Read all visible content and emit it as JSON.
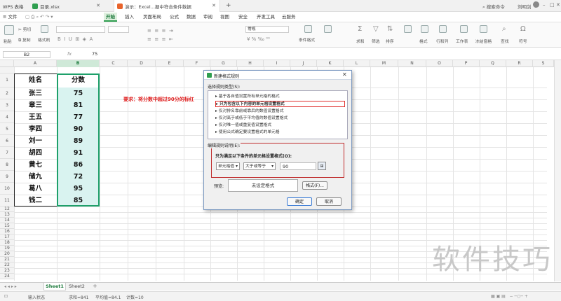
{
  "titlebar": {
    "tabs": [
      {
        "label": "WPS 表格",
        "active": false
      },
      {
        "label": "目录.xlsx",
        "active": false
      },
      {
        "label": "演示：Excel...据中符合条件数据",
        "active": true
      }
    ],
    "search": "搜索命令",
    "user": "刘明剑"
  },
  "menubar": {
    "file": "文件",
    "items": [
      "开始",
      "插入",
      "页面布局",
      "公式",
      "数据",
      "审阅",
      "视图",
      "安全",
      "开发工具",
      "云服务"
    ],
    "selected": "开始"
  },
  "ribbon": {
    "paste": "粘贴",
    "cut": "剪切",
    "copy": "复制",
    "format_painter": "格式刷",
    "number_format": "常规",
    "conditional_format": "条件格式",
    "sum": "求和",
    "filter": "筛选",
    "sort": "排序",
    "format": "格式",
    "rows_cols": "行和列",
    "worksheet": "工作表",
    "freeze": "冻结窗格",
    "find": "查找",
    "symbol": "符号"
  },
  "formula_bar": {
    "cell_ref": "B2",
    "fx": "fx",
    "value": "75"
  },
  "columns": [
    "A",
    "B",
    "C",
    "D",
    "E",
    "F",
    "G",
    "H",
    "I",
    "J",
    "K",
    "L",
    "M",
    "N",
    "O",
    "P",
    "Q",
    "R",
    "S"
  ],
  "rows": [
    "1",
    "2",
    "3",
    "4",
    "5",
    "6",
    "7",
    "8",
    "9",
    "10",
    "11",
    "12",
    "13",
    "14",
    "15",
    "16",
    "17",
    "18",
    "19",
    "20",
    "21",
    "22",
    "23",
    "24",
    "25",
    "26"
  ],
  "table": {
    "headers": [
      "姓名",
      "分数"
    ],
    "rows": [
      [
        "张三",
        "75"
      ],
      [
        "章三",
        "81"
      ],
      [
        "王五",
        "77"
      ],
      [
        "李四",
        "90"
      ],
      [
        "刘一",
        "89"
      ],
      [
        "胡四",
        "91"
      ],
      [
        "黄七",
        "86"
      ],
      [
        "储九",
        "72"
      ],
      [
        "葛八",
        "95"
      ],
      [
        "钱二",
        "85"
      ]
    ]
  },
  "note": "要求：将分数中超过90分的标红",
  "dialog": {
    "title": "新建格式规则",
    "select_rule_type": "选择规则类型(S):",
    "rules": [
      "基于各自值设置所有单元格的格式",
      "只为包含以下内容的单元格设置格式",
      "仅对排名靠前或靠后的数值设置格式",
      "仅对高于或低于平均值的数值设置格式",
      "仅对唯一值或重复值设置格式",
      "使用公式确定要设置格式的单元格"
    ],
    "selected_rule_index": 1,
    "edit_desc": "编辑规则说明(E):",
    "condition_label": "只为满足以下条件的单元格设置格式(O):",
    "cond_type": "单元格值",
    "operator": "大于或等于",
    "value": "90",
    "preview_label": "预览:",
    "preview_text": "未设定格式",
    "format_button": "格式(F)...",
    "ok": "确定",
    "cancel": "取消"
  },
  "sheets": {
    "tabs": [
      "Sheet1",
      "Sheet2"
    ],
    "active": "Sheet1",
    "add": "+"
  },
  "status": {
    "mode": "输入状态",
    "sum": "求和=841",
    "avg": "平均值=84.1",
    "count": "计数=10"
  },
  "watermark": "软件技巧",
  "colors": {
    "accent": "#2e9e4f",
    "highlight": "#d9f3f0",
    "note": "#e02020",
    "rule_border": "#e0302e"
  }
}
